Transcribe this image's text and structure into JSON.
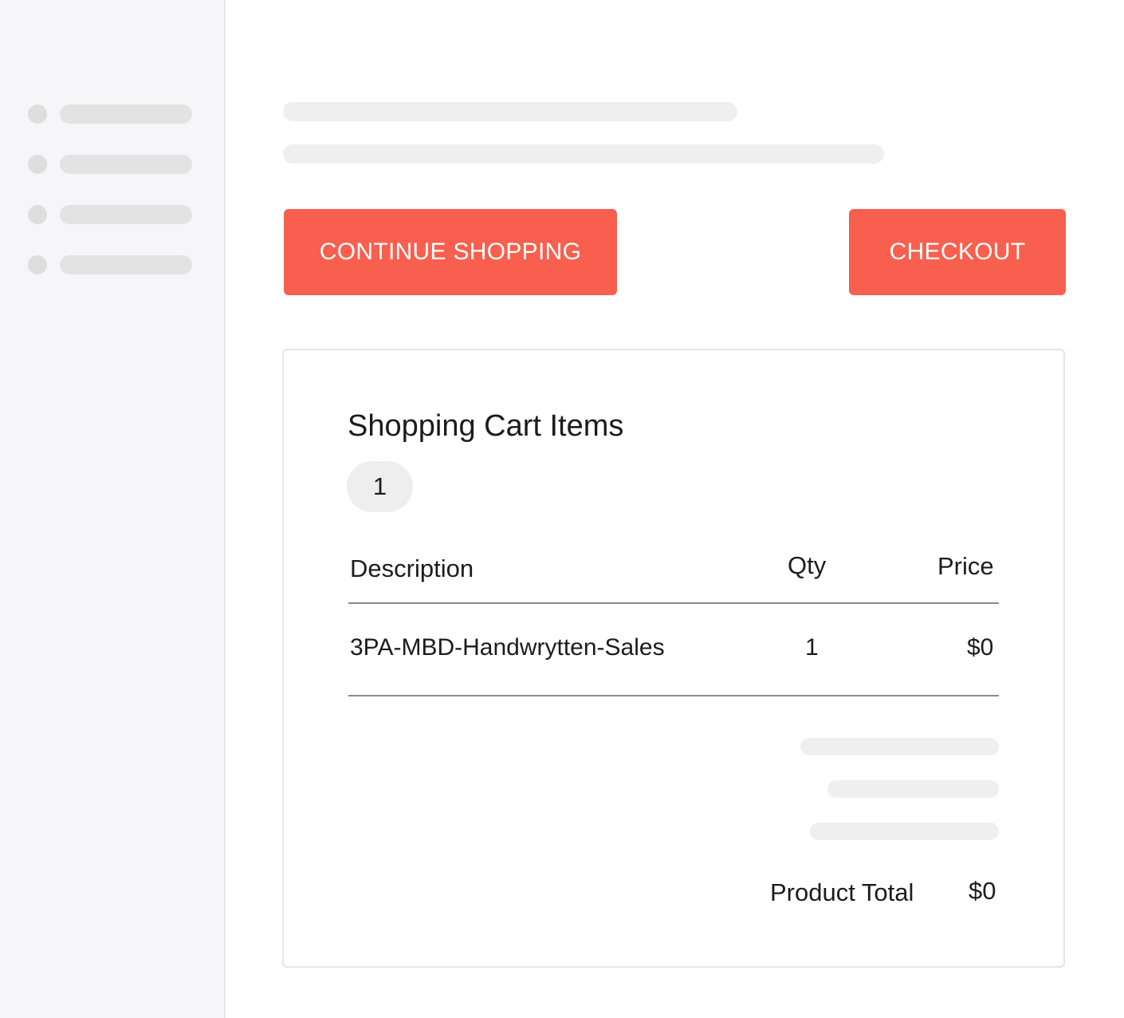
{
  "actions": {
    "continue_label": "CONTINUE SHOPPING",
    "checkout_label": "CHECKOUT"
  },
  "cart": {
    "title": "Shopping Cart Items",
    "item_count": "1",
    "columns": {
      "description": "Description",
      "qty": "Qty",
      "price": "Price"
    },
    "rows": [
      {
        "description": "3PA-MBD-Handwrytten-Sales",
        "qty": "1",
        "price": "$0"
      }
    ],
    "total_label": "Product Total",
    "total_value": "$0"
  },
  "colors": {
    "accent": "#f95f4e",
    "sidebar_bg": "#f6f6f8",
    "placeholder": "#efefef"
  }
}
